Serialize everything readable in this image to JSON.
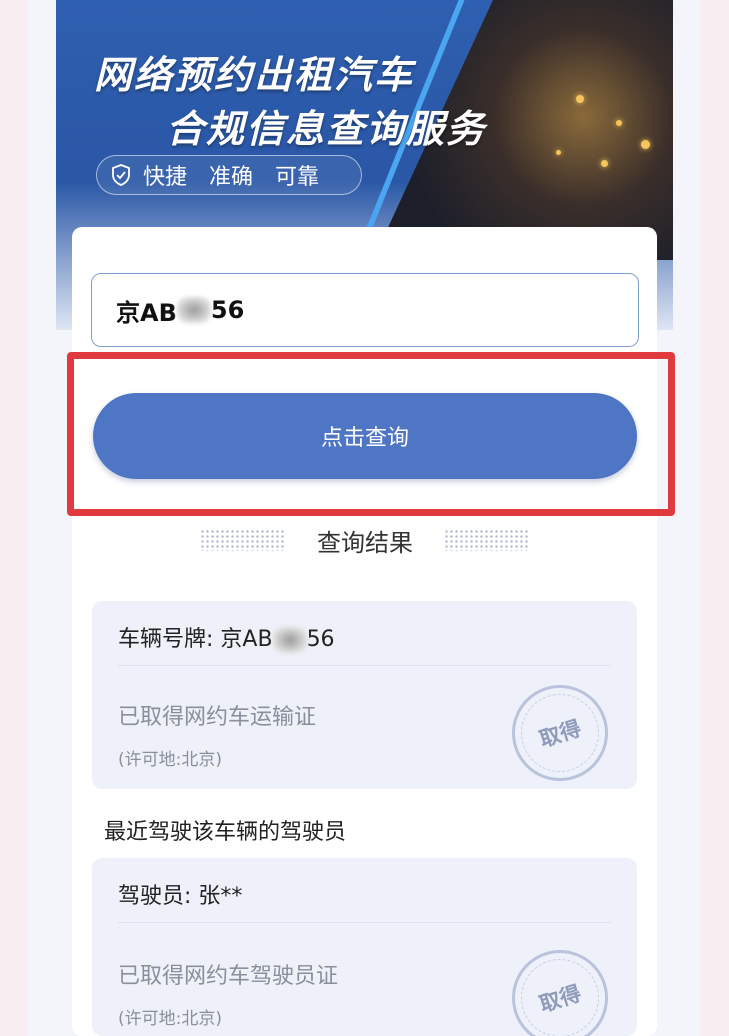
{
  "banner": {
    "title_line1": "网络预约出租汽车",
    "title_line2": "合规信息查询服务",
    "tagline": [
      "快捷",
      "准确",
      "可靠"
    ]
  },
  "search": {
    "plate_prefix": "京AB",
    "plate_suffix": "56"
  },
  "query_button": {
    "label": "点击查询"
  },
  "results": {
    "section_title": "查询结果",
    "vehicle": {
      "plate_label": "车辆号牌: 京AB",
      "plate_suffix": "56",
      "status": "已取得网约车运输证",
      "place": "(许可地:北京)",
      "stamp": "取得"
    },
    "drivers_heading": "最近驾驶该车辆的驾驶员",
    "driver": {
      "name": "驾驶员: 张**",
      "status": "已取得网约车驾驶员证",
      "place": "(许可地:北京)",
      "stamp": "取得"
    }
  },
  "colors": {
    "button": "#4f76c4",
    "highlight": "#e03a3e",
    "banner": "#2f5fb0"
  },
  "icons": {
    "tagline_icon": "shield-check-icon"
  }
}
